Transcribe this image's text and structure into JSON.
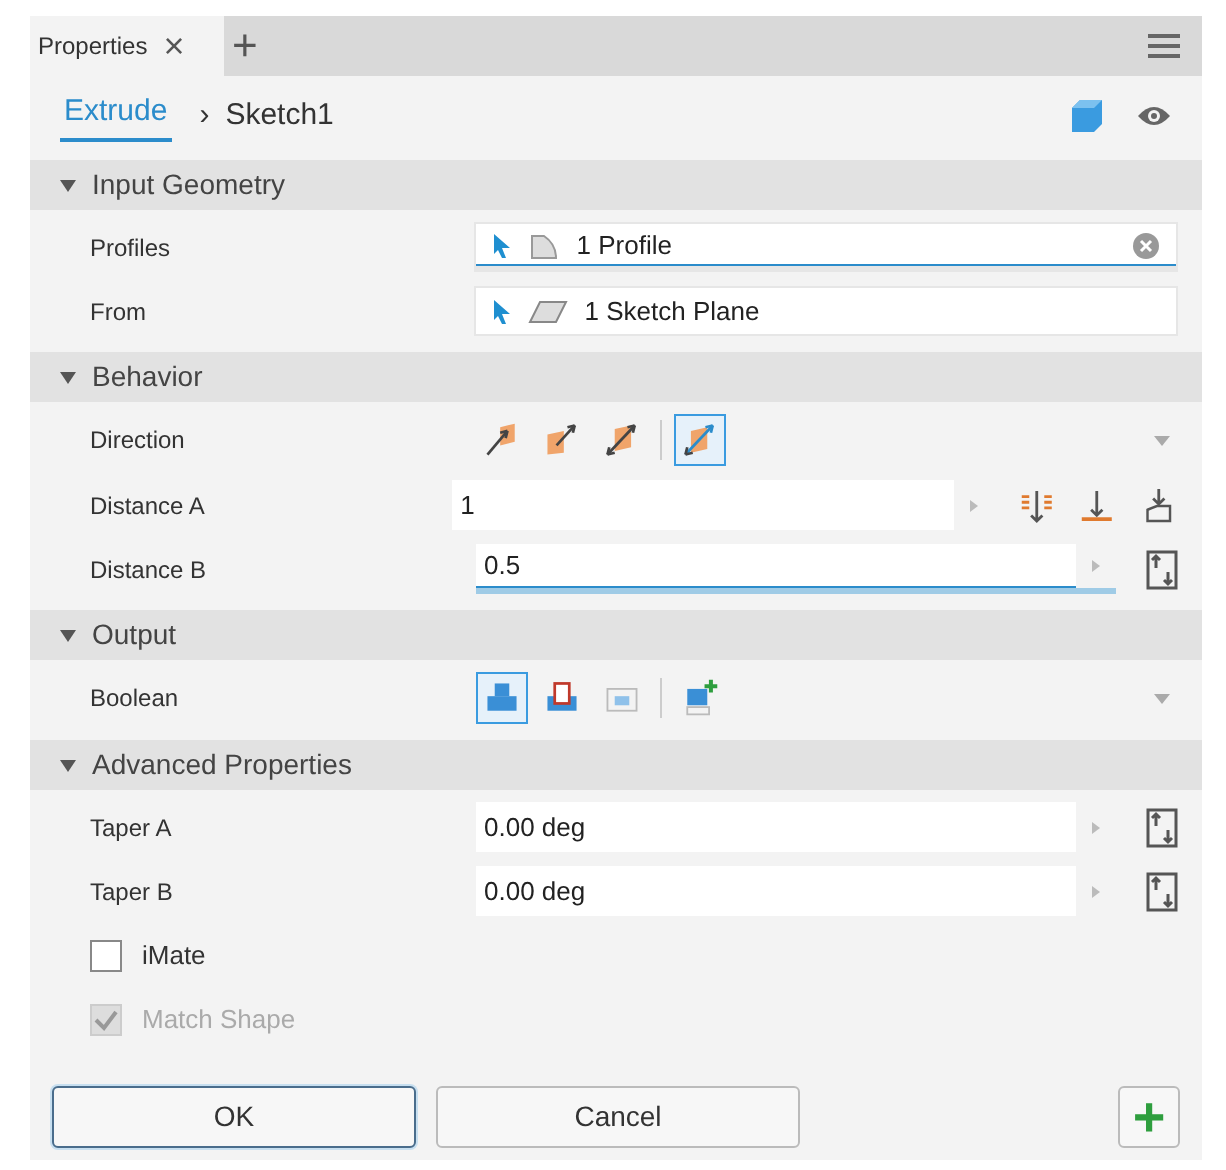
{
  "tab": {
    "label": "Properties",
    "close": "×",
    "add": "+"
  },
  "breadcrumb": {
    "link": "Extrude",
    "separator": "›",
    "current": "Sketch1"
  },
  "sections": [
    {
      "title": "Input Geometry",
      "expanded": true,
      "rows": [
        {
          "kind": "selection",
          "label": "Profiles",
          "value": "1 Profile",
          "focused": true
        },
        {
          "kind": "selection",
          "label": "From",
          "value": "1 Sketch Plane",
          "focused": false
        }
      ]
    },
    {
      "title": "Behavior",
      "expanded": true,
      "rows": [
        {
          "kind": "direction",
          "label": "Direction",
          "options": [
            {
              "selected": false
            },
            {
              "selected": false
            },
            {
              "selected": false
            },
            {
              "selected": true
            }
          ]
        },
        {
          "kind": "distance",
          "label": "Distance A",
          "value": "1",
          "focused": false
        },
        {
          "kind": "number",
          "label": "Distance B",
          "value": "0.5",
          "focused": true
        }
      ]
    },
    {
      "title": "Output",
      "expanded": true,
      "rows": [
        {
          "kind": "boolean",
          "label": "Boolean",
          "options": [
            {
              "selected": true
            },
            {
              "selected": false
            },
            {
              "selected": false
            },
            {
              "selected": false
            }
          ]
        }
      ]
    },
    {
      "title": "Advanced Properties",
      "expanded": true,
      "rows": [
        {
          "kind": "number",
          "label": "Taper A",
          "value": "0.00 deg",
          "focused": false
        },
        {
          "kind": "number",
          "label": "Taper B",
          "value": "0.00 deg",
          "focused": false
        },
        {
          "kind": "checkbox",
          "label": "iMate",
          "checked": false,
          "disabled": false
        },
        {
          "kind": "checkbox",
          "label": "Match Shape",
          "checked": true,
          "disabled": true
        }
      ]
    }
  ],
  "buttons": [
    {
      "label": "OK",
      "selected": true
    },
    {
      "label": "Cancel",
      "selected": false
    }
  ],
  "add_button": "+"
}
